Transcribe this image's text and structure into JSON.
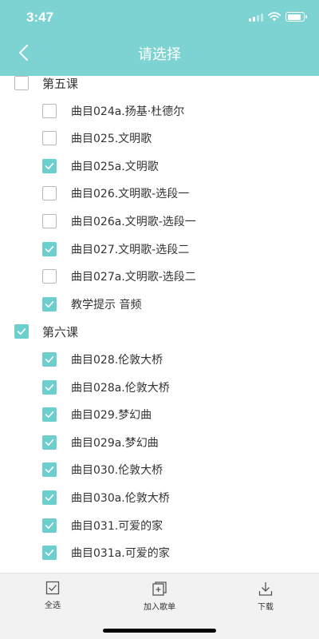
{
  "status_bar": {
    "time": "3:47"
  },
  "header": {
    "title": "请选择"
  },
  "colors": {
    "accent": "#7dd3d1",
    "checkbox_checked": "#6ccfcd"
  },
  "items": [
    {
      "label": "第五课",
      "checked": false,
      "level": 0
    },
    {
      "label": "曲目024a.扬基·杜德尔",
      "checked": false,
      "level": 1
    },
    {
      "label": "曲目025.文明歌",
      "checked": false,
      "level": 1
    },
    {
      "label": "曲目025a.文明歌",
      "checked": true,
      "level": 1
    },
    {
      "label": "曲目026.文明歌-选段一",
      "checked": false,
      "level": 1
    },
    {
      "label": "曲目026a.文明歌-选段一",
      "checked": false,
      "level": 1
    },
    {
      "label": "曲目027.文明歌-选段二",
      "checked": true,
      "level": 1
    },
    {
      "label": "曲目027a.文明歌-选段二",
      "checked": false,
      "level": 1
    },
    {
      "label": "教学提示 音频",
      "checked": true,
      "level": 1
    },
    {
      "label": "第六课",
      "checked": true,
      "level": 0
    },
    {
      "label": "曲目028.伦敦大桥",
      "checked": true,
      "level": 1
    },
    {
      "label": "曲目028a.伦敦大桥",
      "checked": true,
      "level": 1
    },
    {
      "label": "曲目029.梦幻曲",
      "checked": true,
      "level": 1
    },
    {
      "label": "曲目029a.梦幻曲",
      "checked": true,
      "level": 1
    },
    {
      "label": "曲目030.伦敦大桥",
      "checked": true,
      "level": 1
    },
    {
      "label": "曲目030a.伦敦大桥",
      "checked": true,
      "level": 1
    },
    {
      "label": "曲目031.可爱的家",
      "checked": true,
      "level": 1
    },
    {
      "label": "曲目031a.可爱的家",
      "checked": true,
      "level": 1
    }
  ],
  "toolbar": {
    "select_all": "全选",
    "add_to_playlist": "加入歌单",
    "download": "下载"
  }
}
